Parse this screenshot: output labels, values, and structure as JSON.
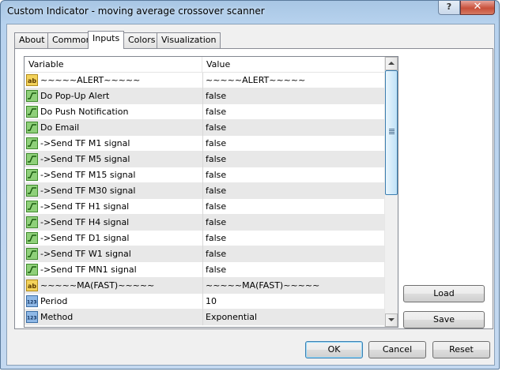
{
  "window": {
    "title": "Custom Indicator - moving average crossover scanner",
    "help_label": "?",
    "close_label": "✕"
  },
  "tabs": [
    {
      "label": "About",
      "active": false
    },
    {
      "label": "Common",
      "active": false
    },
    {
      "label": "Inputs",
      "active": true
    },
    {
      "label": "Colors",
      "active": false
    },
    {
      "label": "Visualization",
      "active": false
    }
  ],
  "grid": {
    "columns": [
      "Variable",
      "Value"
    ],
    "rows": [
      {
        "icon": "ab-string-icon",
        "variable": "~~~~~ALERT~~~~~",
        "value": "~~~~~ALERT~~~~~"
      },
      {
        "icon": "bool-icon",
        "variable": "Do Pop-Up Alert",
        "value": "false"
      },
      {
        "icon": "bool-icon",
        "variable": "Do Push Notification",
        "value": "false"
      },
      {
        "icon": "bool-icon",
        "variable": "Do Email",
        "value": "false"
      },
      {
        "icon": "bool-icon",
        "variable": "->Send TF M1 signal",
        "value": "false"
      },
      {
        "icon": "bool-icon",
        "variable": "->Send TF M5 signal",
        "value": "false"
      },
      {
        "icon": "bool-icon",
        "variable": "->Send TF M15 signal",
        "value": "false"
      },
      {
        "icon": "bool-icon",
        "variable": "->Send TF M30 signal",
        "value": "false"
      },
      {
        "icon": "bool-icon",
        "variable": "->Send TF H1 signal",
        "value": "false"
      },
      {
        "icon": "bool-icon",
        "variable": "->Send TF H4 signal",
        "value": "false"
      },
      {
        "icon": "bool-icon",
        "variable": "->Send TF D1 signal",
        "value": "false"
      },
      {
        "icon": "bool-icon",
        "variable": "->Send TF W1 signal",
        "value": "false"
      },
      {
        "icon": "bool-icon",
        "variable": "->Send TF MN1 signal",
        "value": "false"
      },
      {
        "icon": "ab-string-icon",
        "variable": "~~~~~MA(FAST)~~~~~",
        "value": "~~~~~MA(FAST)~~~~~"
      },
      {
        "icon": "123-int-icon",
        "variable": "Period",
        "value": "10"
      },
      {
        "icon": "123-int-icon",
        "variable": "Method",
        "value": "Exponential"
      }
    ]
  },
  "side_buttons": {
    "load": "Load",
    "save": "Save"
  },
  "footer": {
    "ok": "OK",
    "cancel": "Cancel",
    "reset": "Reset"
  }
}
